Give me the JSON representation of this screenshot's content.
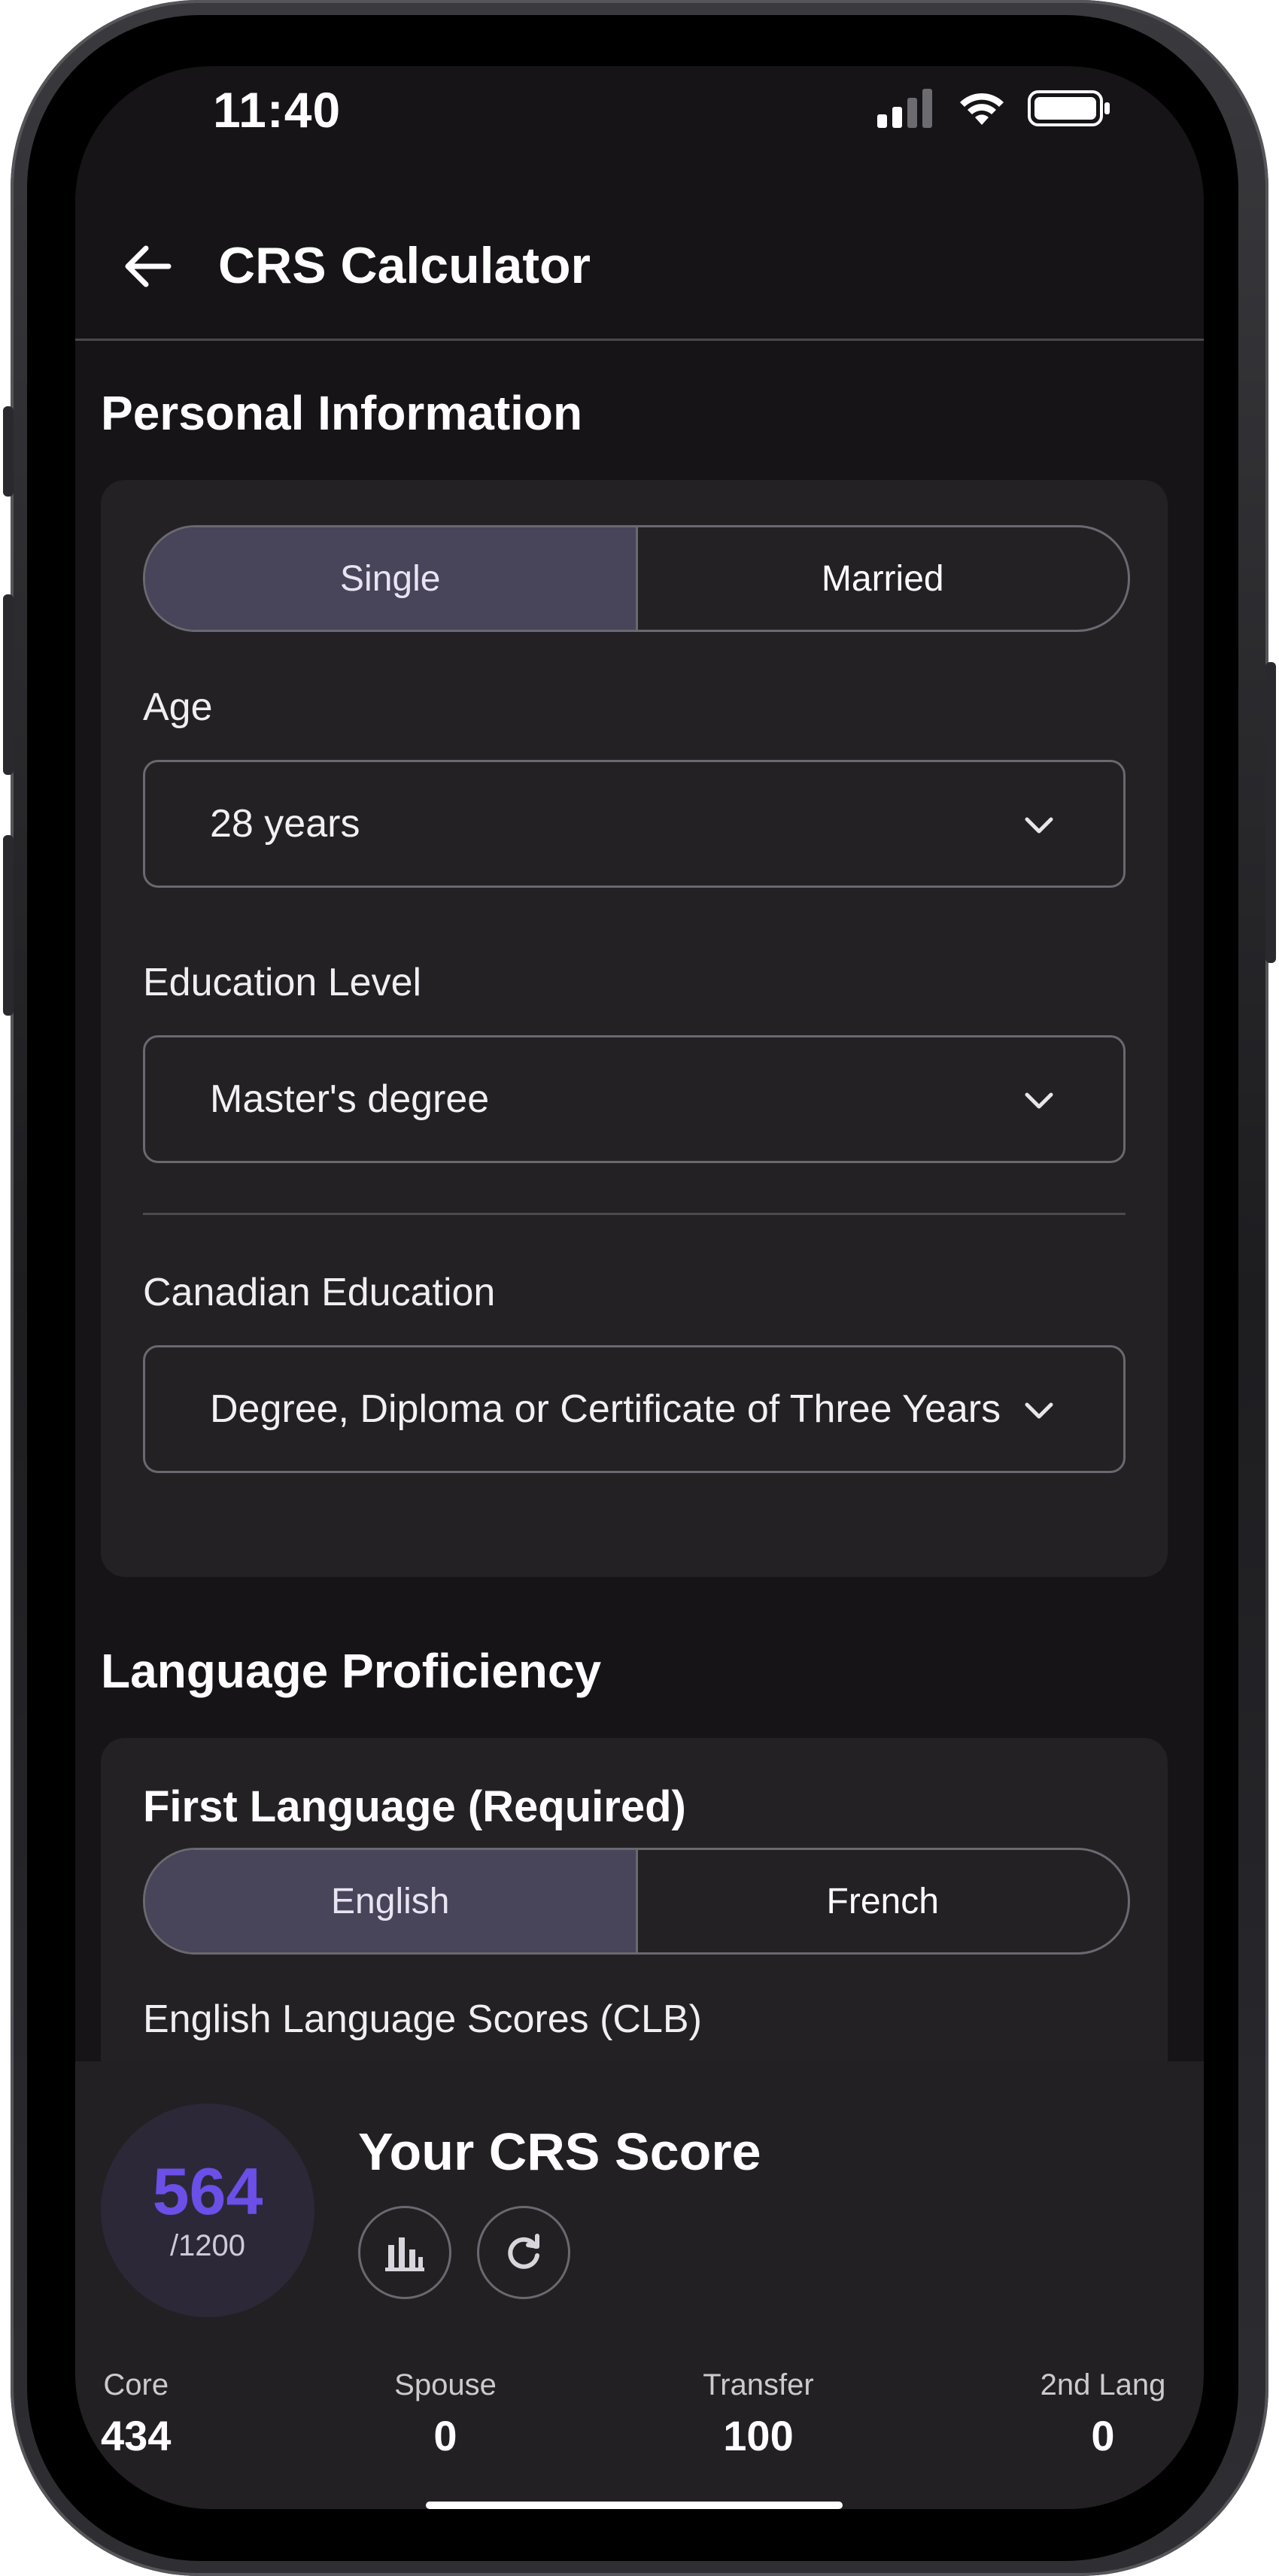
{
  "status_bar": {
    "time": "11:40"
  },
  "app_bar": {
    "title": "CRS Calculator"
  },
  "personal": {
    "section_title": "Personal Information",
    "marital_options": [
      "Single",
      "Married"
    ],
    "marital_selected": "Single",
    "age_label": "Age",
    "age_value": "28 years",
    "education_label": "Education Level",
    "education_value": "Master's degree",
    "canadian_education_label": "Canadian Education",
    "canadian_education_value": "Degree, Diploma or Certificate of Three Years or Longer"
  },
  "language": {
    "section_title": "Language Proficiency",
    "first_language_label": "First Language (Required)",
    "language_options": [
      "English",
      "French"
    ],
    "language_selected": "English",
    "scores_label": "English Language Scores (CLB)"
  },
  "score": {
    "value": "564",
    "max": "/1200",
    "title": "Your CRS Score",
    "breakdown": [
      {
        "label": "Core",
        "value": "434"
      },
      {
        "label": "Spouse",
        "value": "0"
      },
      {
        "label": "Transfer",
        "value": "100"
      },
      {
        "label": "2nd Lang",
        "value": "0"
      }
    ]
  },
  "colors": {
    "accent": "#6b4fe6",
    "segment_active": "#48445a",
    "background": "#161416",
    "card": "#232123"
  },
  "icons": [
    "back-arrow-icon",
    "chevron-down-icon",
    "bar-chart-icon",
    "refresh-icon",
    "cellular-signal-icon",
    "wifi-icon",
    "battery-icon"
  ]
}
